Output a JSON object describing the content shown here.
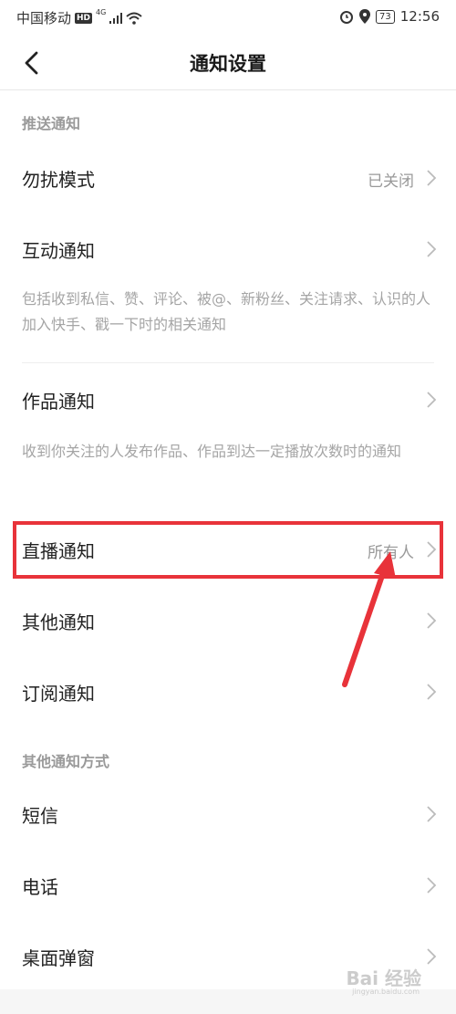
{
  "statusbar": {
    "carrier": "中国移动",
    "hd": "HD",
    "network": "4G",
    "battery": "73",
    "time": "12:56"
  },
  "header": {
    "title": "通知设置"
  },
  "sections": {
    "push": "推送通知",
    "other_methods": "其他通知方式"
  },
  "rows": {
    "dnd": {
      "label": "勿扰模式",
      "value": "已关闭"
    },
    "interaction": {
      "label": "互动通知",
      "desc": "包括收到私信、赞、评论、被@、新粉丝、关注请求、认识的人加入快手、戳一下时的相关通知"
    },
    "works": {
      "label": "作品通知",
      "desc": "收到你关注的人发布作品、作品到达一定播放次数时的通知"
    },
    "live": {
      "label": "直播通知",
      "value": "所有人"
    },
    "other": {
      "label": "其他通知"
    },
    "subscribe": {
      "label": "订阅通知"
    },
    "sms": {
      "label": "短信"
    },
    "phone": {
      "label": "电话"
    },
    "desktop_popup": {
      "label": "桌面弹窗"
    }
  },
  "watermark": {
    "text": "Bai 经验",
    "url": "jingyan.baidu.com"
  },
  "colors": {
    "annotation": "#e8333a"
  }
}
